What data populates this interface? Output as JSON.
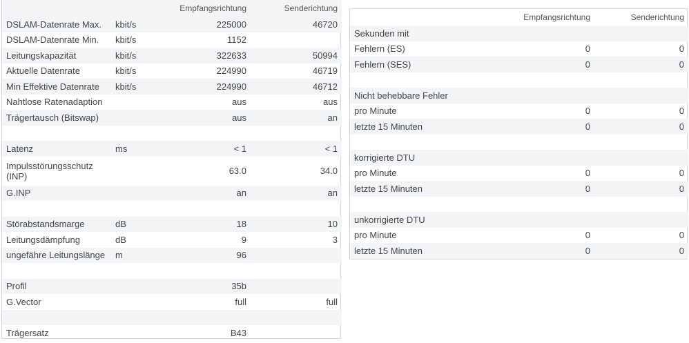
{
  "left": {
    "headers": {
      "col1": "",
      "unit": "",
      "rx": "Empfangsrichtung",
      "tx": "Senderichtung"
    },
    "rows": [
      {
        "label": "DSLAM-Datenrate Max.",
        "unit": "kbit/s",
        "rx": "225000",
        "tx": "46720"
      },
      {
        "label": "DSLAM-Datenrate Min.",
        "unit": "kbit/s",
        "rx": "1152",
        "tx": ""
      },
      {
        "label": "Leitungskapazität",
        "unit": "kbit/s",
        "rx": "322633",
        "tx": "50994"
      },
      {
        "label": "Aktuelle Datenrate",
        "unit": "kbit/s",
        "rx": "224990",
        "tx": "46719"
      },
      {
        "label": "Min Effektive Datenrate",
        "unit": "kbit/s",
        "rx": "224990",
        "tx": "46712"
      },
      {
        "label": "Nahtlose Ratenadaption",
        "unit": "",
        "rx": "aus",
        "tx": "aus"
      },
      {
        "label": "Trägertausch (Bitswap)",
        "unit": "",
        "rx": "aus",
        "tx": "an"
      },
      {
        "label": "",
        "unit": "",
        "rx": "",
        "tx": ""
      },
      {
        "label": "Latenz",
        "unit": "ms",
        "rx": "< 1",
        "tx": "< 1"
      },
      {
        "label": "Impulsstörungsschutz (INP)",
        "unit": "",
        "rx": "63.0",
        "tx": "34.0"
      },
      {
        "label": "G.INP",
        "unit": "",
        "rx": "an",
        "tx": "an"
      },
      {
        "label": "",
        "unit": "",
        "rx": "",
        "tx": ""
      },
      {
        "label": "Störabstandsmarge",
        "unit": "dB",
        "rx": "18",
        "tx": "10"
      },
      {
        "label": "Leitungsdämpfung",
        "unit": "dB",
        "rx": "9",
        "tx": "3"
      },
      {
        "label": "ungefähre Leitungslänge",
        "unit": "m",
        "rx": "96",
        "tx": ""
      },
      {
        "label": "",
        "unit": "",
        "rx": "",
        "tx": ""
      },
      {
        "label": "Profil",
        "unit": "",
        "rx": "35b",
        "tx": ""
      },
      {
        "label": "G.Vector",
        "unit": "",
        "rx": "full",
        "tx": "full"
      },
      {
        "label": "",
        "unit": "",
        "rx": "",
        "tx": ""
      },
      {
        "label": "Trägersatz",
        "unit": "",
        "rx": "B43",
        "tx": ""
      }
    ]
  },
  "right": {
    "headers": {
      "col1": "",
      "rx": "Empfangsrichtung",
      "tx": "Senderichtung"
    },
    "rows": [
      {
        "label": "Sekunden mit",
        "rx": "",
        "tx": ""
      },
      {
        "label": "Fehlern (ES)",
        "rx": "0",
        "tx": "0"
      },
      {
        "label": "Fehlern (SES)",
        "rx": "0",
        "tx": "0"
      },
      {
        "label": "",
        "rx": "",
        "tx": ""
      },
      {
        "label": "Nicht behebbare Fehler",
        "rx": "",
        "tx": ""
      },
      {
        "label": "pro Minute",
        "rx": "0",
        "tx": "0"
      },
      {
        "label": "letzte 15 Minuten",
        "rx": "0",
        "tx": "0"
      },
      {
        "label": "",
        "rx": "",
        "tx": ""
      },
      {
        "label": "korrigierte DTU",
        "rx": "",
        "tx": ""
      },
      {
        "label": "pro Minute",
        "rx": "0",
        "tx": "0"
      },
      {
        "label": "letzte 15 Minuten",
        "rx": "0",
        "tx": "0"
      },
      {
        "label": "",
        "rx": "",
        "tx": ""
      },
      {
        "label": "unkorrigierte DTU",
        "rx": "",
        "tx": ""
      },
      {
        "label": "pro Minute",
        "rx": "0",
        "tx": "0"
      },
      {
        "label": "letzte 15 Minuten",
        "rx": "0",
        "tx": "0"
      }
    ]
  }
}
